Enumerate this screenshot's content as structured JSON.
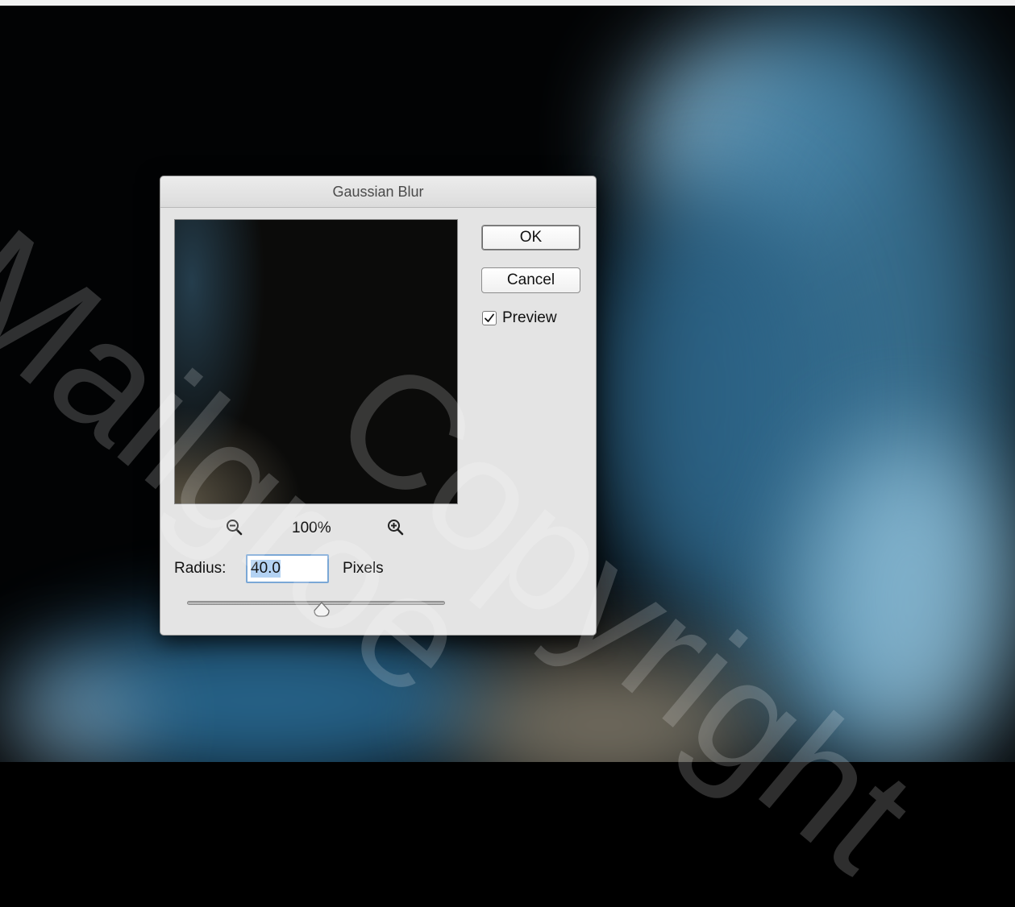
{
  "dialog": {
    "title": "Gaussian Blur",
    "ok_label": "OK",
    "cancel_label": "Cancel",
    "preview_label": "Preview",
    "preview_checked": true,
    "zoom_level": "100%",
    "radius_label": "Radius:",
    "radius_value": "40.0",
    "radius_unit": "Pixels"
  },
  "icons": {
    "zoom_out": "zoom-out-icon",
    "zoom_in": "zoom-in-icon",
    "checkmark": "checkmark-icon",
    "slider_thumb": "slider-thumb-icon"
  },
  "watermark": {
    "line1": "Mailgroe",
    "line2": "Copyright"
  },
  "colors": {
    "dialog_bg": "#e4e4e4",
    "selection": "#b3d2f3",
    "focus_ring": "#7aa7d6",
    "canvas_blue": "#4a86ab",
    "canvas_black": "#020304"
  }
}
